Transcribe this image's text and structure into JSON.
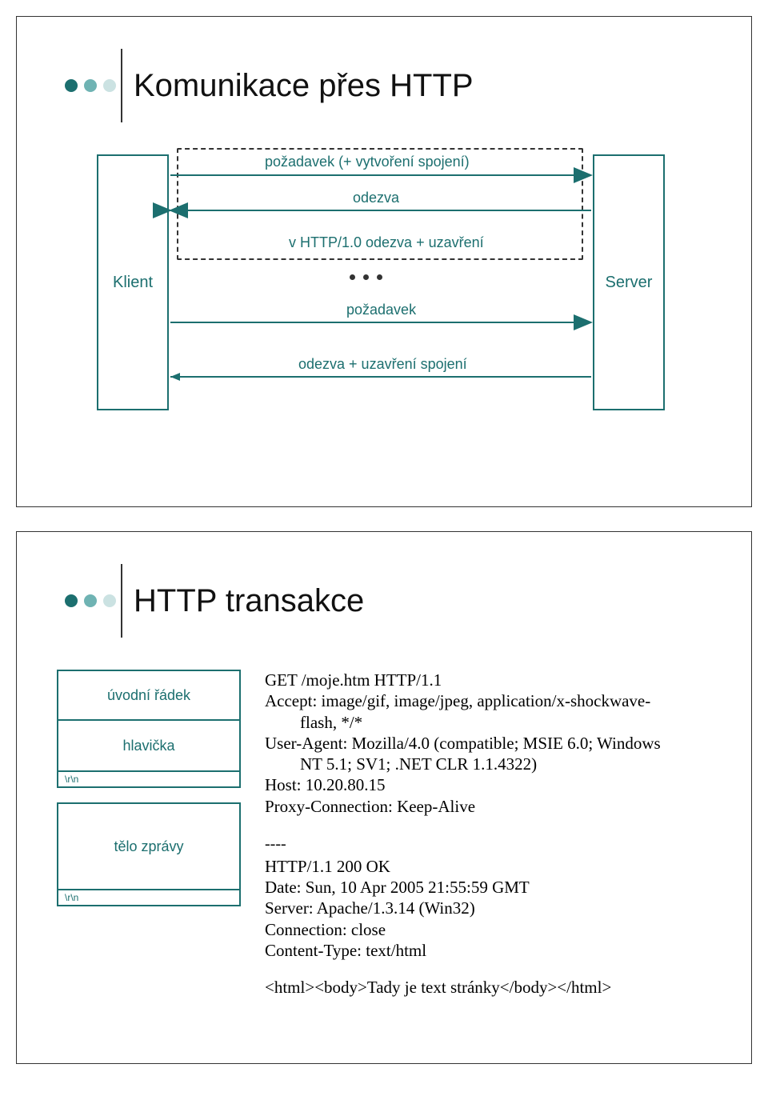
{
  "slide1": {
    "title": "Komunikace přes HTTP",
    "client": "Klient",
    "server": "Server",
    "label_request": "požadavek (+ vytvoření spojení)",
    "label_response": "odezva",
    "label_http10": "v HTTP/1.0 odezva + uzavření",
    "label_request2": "požadavek",
    "label_close": "odezva + uzavření spojení"
  },
  "slide2": {
    "title": "HTTP transakce",
    "struct": {
      "first_line": "úvodní řádek",
      "header": "hlavička",
      "crlf": "\\r\\n",
      "body": "tělo zprávy"
    },
    "request": {
      "line1": "GET /moje.htm HTTP/1.1",
      "line2a": "Accept: image/gif, image/jpeg, application/x-shockwave-",
      "line2b": "flash, */*",
      "line3a": "User-Agent: Mozilla/4.0 (compatible; MSIE 6.0; Windows",
      "line3b": "NT 5.1; SV1; .NET CLR 1.1.4322)",
      "line4": "Host: 10.20.80.15",
      "line5": "Proxy-Connection: Keep-Alive"
    },
    "separator": "----",
    "response": {
      "line1": "HTTP/1.1 200 OK",
      "line2": "Date: Sun, 10 Apr 2005 21:55:59 GMT",
      "line3": "Server: Apache/1.3.14 (Win32)",
      "line4": "Connection: close",
      "line5": "Content-Type: text/html",
      "blank": "",
      "line6": "<html><body>Tady je text stránky</body></html>"
    }
  }
}
